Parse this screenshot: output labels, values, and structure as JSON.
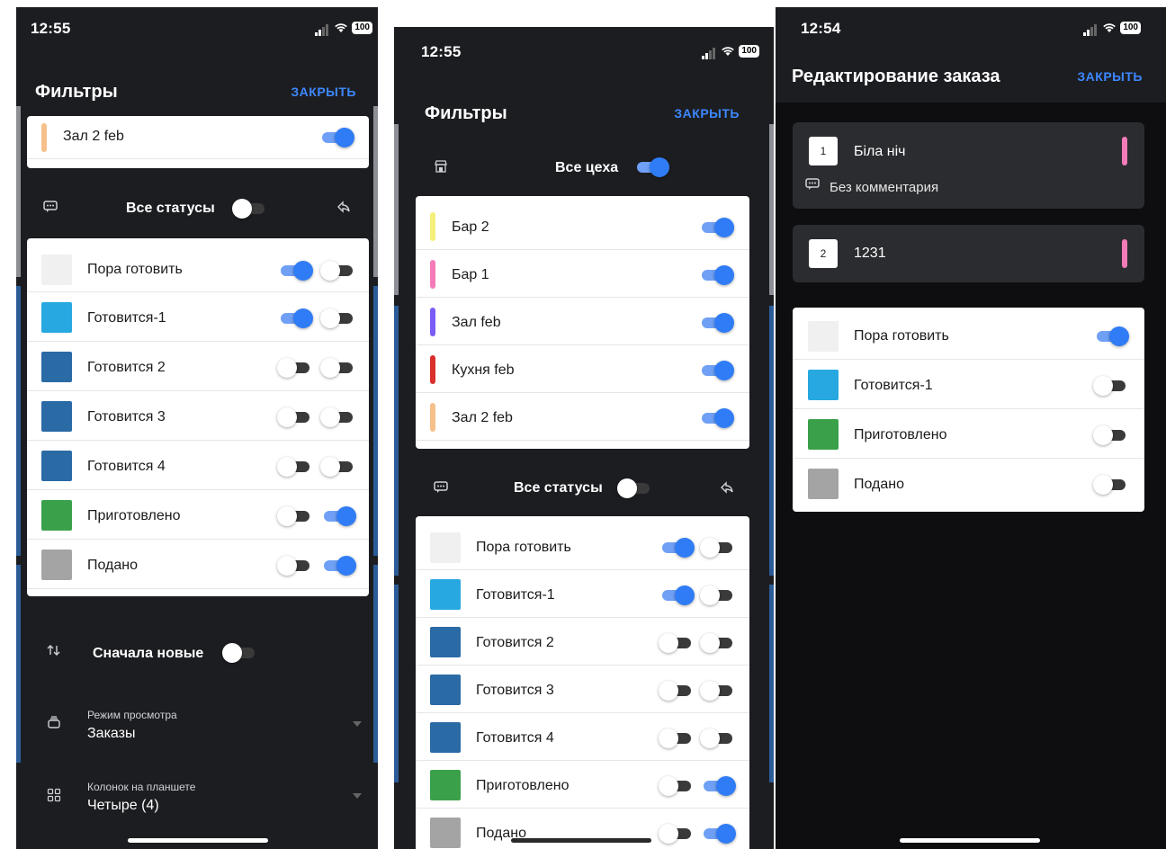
{
  "colors": {
    "accent": "#2f7cf6",
    "bar_yellow": "#f5f07a",
    "bar_pink": "#f47bb8",
    "bar_purple": "#7b5cf5",
    "bar_red": "#d8302c",
    "bar_peach": "#f5c08a",
    "st_light": "#f0f0f0",
    "st_cyan": "#27a8e0",
    "st_blue": "#2a6aa5",
    "st_green": "#3aa14a",
    "st_gray": "#a4a4a4"
  },
  "screen1": {
    "time": "12:55",
    "battery": "100",
    "title": "Фильтры",
    "close": "ЗАКРЫТЬ",
    "top_item": {
      "label": "Зал 2 feb",
      "on": true
    },
    "statuses_title": "Все статусы",
    "statuses": [
      {
        "label": "Пора готовить"
      },
      {
        "label": "Готовится-1"
      },
      {
        "label": "Готовится 2"
      },
      {
        "label": "Готовится 3"
      },
      {
        "label": "Готовится 4"
      },
      {
        "label": "Приготовлено"
      },
      {
        "label": "Подано"
      }
    ],
    "sort_label": "Сначала новые",
    "view_mode": {
      "label": "Режим просмотра",
      "value": "Заказы"
    },
    "columns": {
      "label": "Колонок на планшете",
      "value": "Четыре (4)"
    }
  },
  "screen2": {
    "time": "12:55",
    "battery": "100",
    "title": "Фильтры",
    "close": "ЗАКРЫТЬ",
    "workshops_title": "Все цеха",
    "workshops": [
      {
        "label": "Бар 2"
      },
      {
        "label": "Бар 1"
      },
      {
        "label": "Зал feb"
      },
      {
        "label": "Кухня feb"
      },
      {
        "label": "Зал 2 feb"
      }
    ],
    "statuses_title": "Все статусы",
    "statuses": [
      {
        "label": "Пора готовить"
      },
      {
        "label": "Готовится-1"
      },
      {
        "label": "Готовится 2"
      },
      {
        "label": "Готовится 3"
      },
      {
        "label": "Готовится 4"
      },
      {
        "label": "Приготовлено"
      },
      {
        "label": "Подано"
      }
    ]
  },
  "screen3": {
    "time": "12:54",
    "battery": "100",
    "title": "Редактирование заказа",
    "close": "ЗАКРЫТЬ",
    "orders": [
      {
        "num": "1",
        "name": "Біла ніч",
        "comment": "Без комментария"
      },
      {
        "num": "2",
        "name": "1231"
      }
    ],
    "statuses": [
      {
        "label": "Пора готовить"
      },
      {
        "label": "Готовится-1"
      },
      {
        "label": "Приготовлено"
      },
      {
        "label": "Подано"
      }
    ]
  }
}
